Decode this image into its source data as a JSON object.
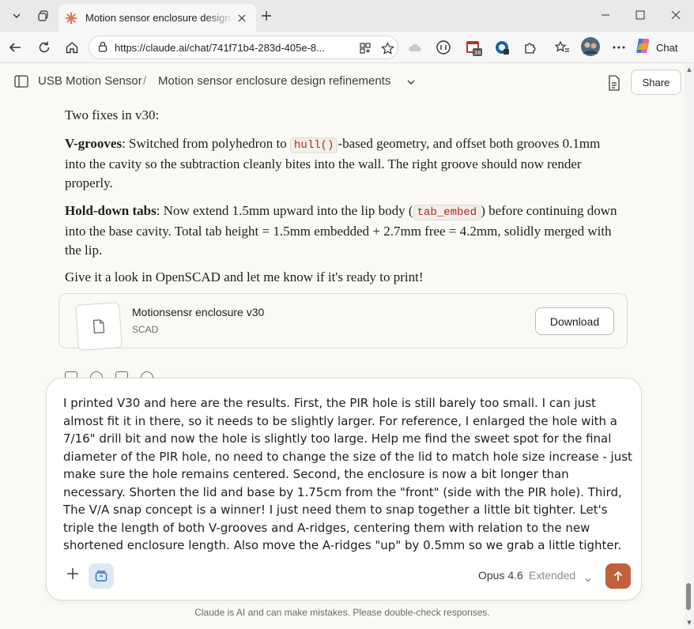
{
  "browser": {
    "tab_title": "Motion sensor enclosure design refinements",
    "url": "https://claude.ai/chat/741f71b4-283d-405e-8...",
    "copilot_label": "Chat",
    "extension_badge": "38"
  },
  "header": {
    "project": "USB Motion Sensor",
    "separator": "/",
    "chat_title": "Motion sensor enclosure design refinements",
    "share_label": "Share"
  },
  "message": {
    "intro": "Two fixes in v30:",
    "p1_bold": "V-grooves",
    "p1_a": ": Switched from polyhedron to ",
    "p1_code": "hull()",
    "p1_b": "-based geometry, and offset both grooves 0.1mm into the cavity so the subtraction cleanly bites into the wall. The right groove should now render properly.",
    "p2_bold": "Hold-down tabs",
    "p2_a": ": Now extend 1.5mm upward into the lip body (",
    "p2_code": "tab_embed",
    "p2_b": ") before continuing down into the base cavity. Total tab height = 1.5mm embedded + 2.7mm free = 4.2mm, solidly merged with the lip.",
    "outro": "Give it a look in OpenSCAD and let me know if it's ready to print!"
  },
  "artifact": {
    "title": "Motionsensr enclosure v30",
    "type": "SCAD",
    "download_label": "Download"
  },
  "composer": {
    "text": "I printed V30 and here are the results. First, the PIR hole is still barely too small. I can just almost fit it in there, so it needs to be slightly larger. For reference, I enlarged the hole with a 7/16\" drill bit and now the hole is slightly too large. Help me find the sweet spot for the final diameter of the PIR hole, no need to change the size of the lid to match hole size increase - just make sure the hole remains centered. Second, the enclosure is now a bit longer than necessary. Shorten the lid and base by 1.75cm from the \"front\" (side with the PIR hole). Third, The V/A snap concept is a winner! I just need them to snap together a little bit tighter. Let's triple the length of both V-grooves and A-ridges, centering them with relation to the new shortened enclosure length. Also move the A-ridges \"up\" by 0.5mm so we grab a little tighter.",
    "model": "Opus 4.6",
    "mode": "Extended"
  },
  "disclaimer": "Claude is AI and can make mistakes. Please double-check responses.",
  "colors": {
    "accent": "#c2603c",
    "code_text": "#b3261e",
    "background": "#faf9f5"
  }
}
